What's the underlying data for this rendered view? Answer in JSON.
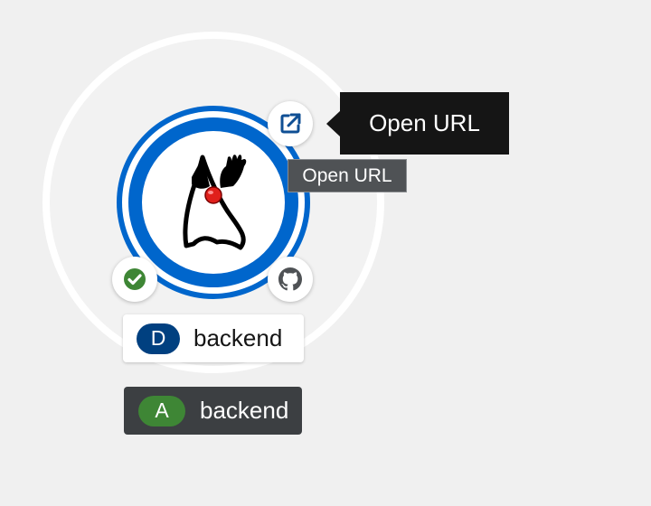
{
  "tooltip": {
    "text": "Open URL"
  },
  "native_title": {
    "text": "Open URL"
  },
  "node": {
    "icon": "java-duke-icon",
    "decorators": {
      "url": "open-url-icon",
      "status": "check-circle-icon",
      "git": "github-icon"
    }
  },
  "labels": [
    {
      "badge": "D",
      "text": "backend",
      "badge_color": "#004080"
    },
    {
      "badge": "A",
      "text": "backend",
      "badge_color": "#3e8635"
    }
  ],
  "colors": {
    "ring": "#0066cc",
    "success": "#3e8635",
    "tooltip_bg": "#151515"
  }
}
